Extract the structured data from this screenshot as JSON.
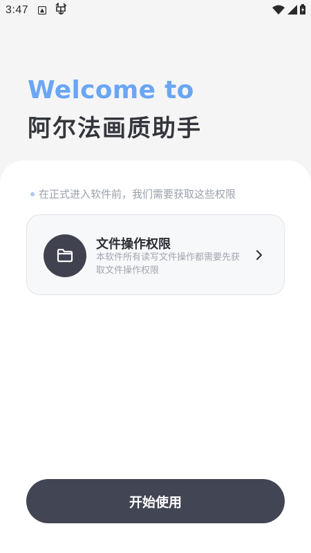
{
  "status_bar": {
    "time": "3:47",
    "icons": [
      "android-notification-icon",
      "cat-app-icon",
      "wifi-icon",
      "signal-icon",
      "battery-icon"
    ]
  },
  "header": {
    "welcome": "Welcome to",
    "app_name": "阿尔法画质助手"
  },
  "permissions": {
    "notice": "在正式进入软件前，我们需要获取这些权限",
    "items": [
      {
        "title": "文件操作权限",
        "description": "本软件所有读写文件操作都需要先获取文件操作权限",
        "icon": "folder-icon"
      }
    ]
  },
  "actions": {
    "start_label": "开始使用"
  },
  "colors": {
    "accent": "#6aa6f3",
    "dark": "#424553",
    "background": "#f5f5f6"
  }
}
